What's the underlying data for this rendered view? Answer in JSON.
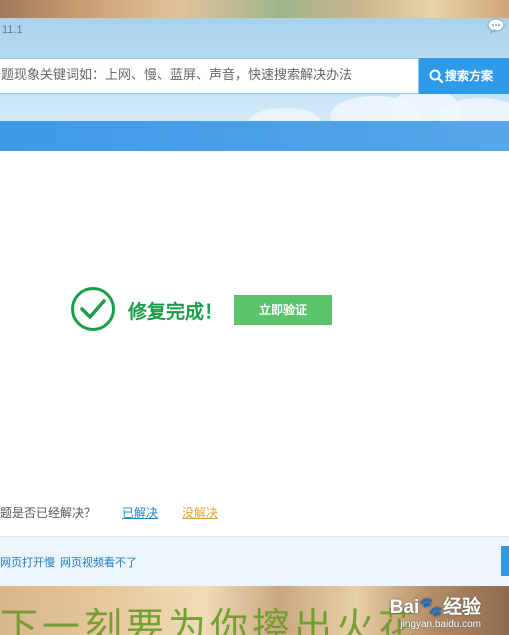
{
  "app": {
    "version": "11.1"
  },
  "search": {
    "placeholder": "题现象关键词如：上网、慢、蓝屏、声音，快速搜索解决办法",
    "button_label": "搜索方案"
  },
  "result": {
    "message": "修复完成！",
    "verify_button": "立即验证"
  },
  "question": {
    "prompt": "题是否已经解决？",
    "solved_label": "已解决",
    "unsolved_label": "没解决"
  },
  "footer": {
    "links": [
      "网页打开慢",
      "网页视频看不了"
    ]
  },
  "background": {
    "bottom_text": "下一刻要为你擦出火花"
  },
  "watermark": {
    "main": "Bai🐾经验",
    "sub": "jingyan.baidu.com"
  },
  "colors": {
    "accent_blue": "#2f9be8",
    "success_green": "#1a9d4b",
    "verify_green": "#5bc46a",
    "unsolved_orange": "#e0a53a"
  }
}
